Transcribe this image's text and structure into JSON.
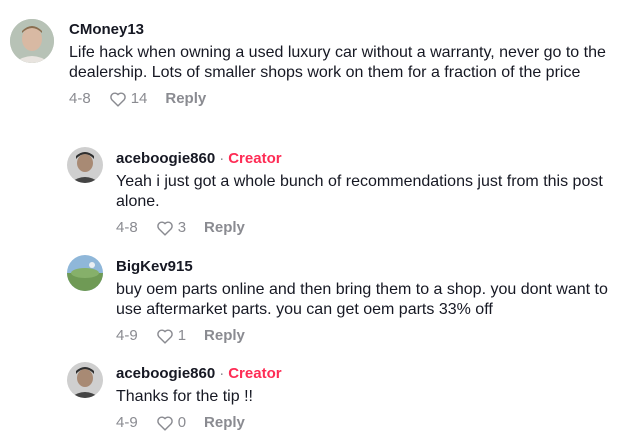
{
  "comments": [
    {
      "username": "CMoney13",
      "text": "Life hack when owning a used luxury car without a warranty, never go to the dealership. Lots of smaller shops work on them for a fraction of the price",
      "date": "4-8",
      "likes": "14",
      "reply_label": "Reply"
    },
    {
      "username": "aceboogie860",
      "separator": "·",
      "badge": "Creator",
      "text": "Yeah i just got a whole bunch of recommendations just from this post alone.",
      "date": "4-8",
      "likes": "3",
      "reply_label": "Reply"
    },
    {
      "username": "BigKev915",
      "text": "buy oem parts online and then bring them to a shop. you dont want to use aftermarket parts. you can get oem parts 33% off",
      "date": "4-9",
      "likes": "1",
      "reply_label": "Reply"
    },
    {
      "username": "aceboogie860",
      "separator": "·",
      "badge": "Creator",
      "text": "Thanks for the tip !!",
      "date": "4-9",
      "likes": "0",
      "reply_label": "Reply"
    }
  ],
  "colors": {
    "text": "#161823",
    "muted": "#8a8b91",
    "creator": "#fe2c55"
  },
  "icons": {
    "like": "heart-outline-icon"
  }
}
